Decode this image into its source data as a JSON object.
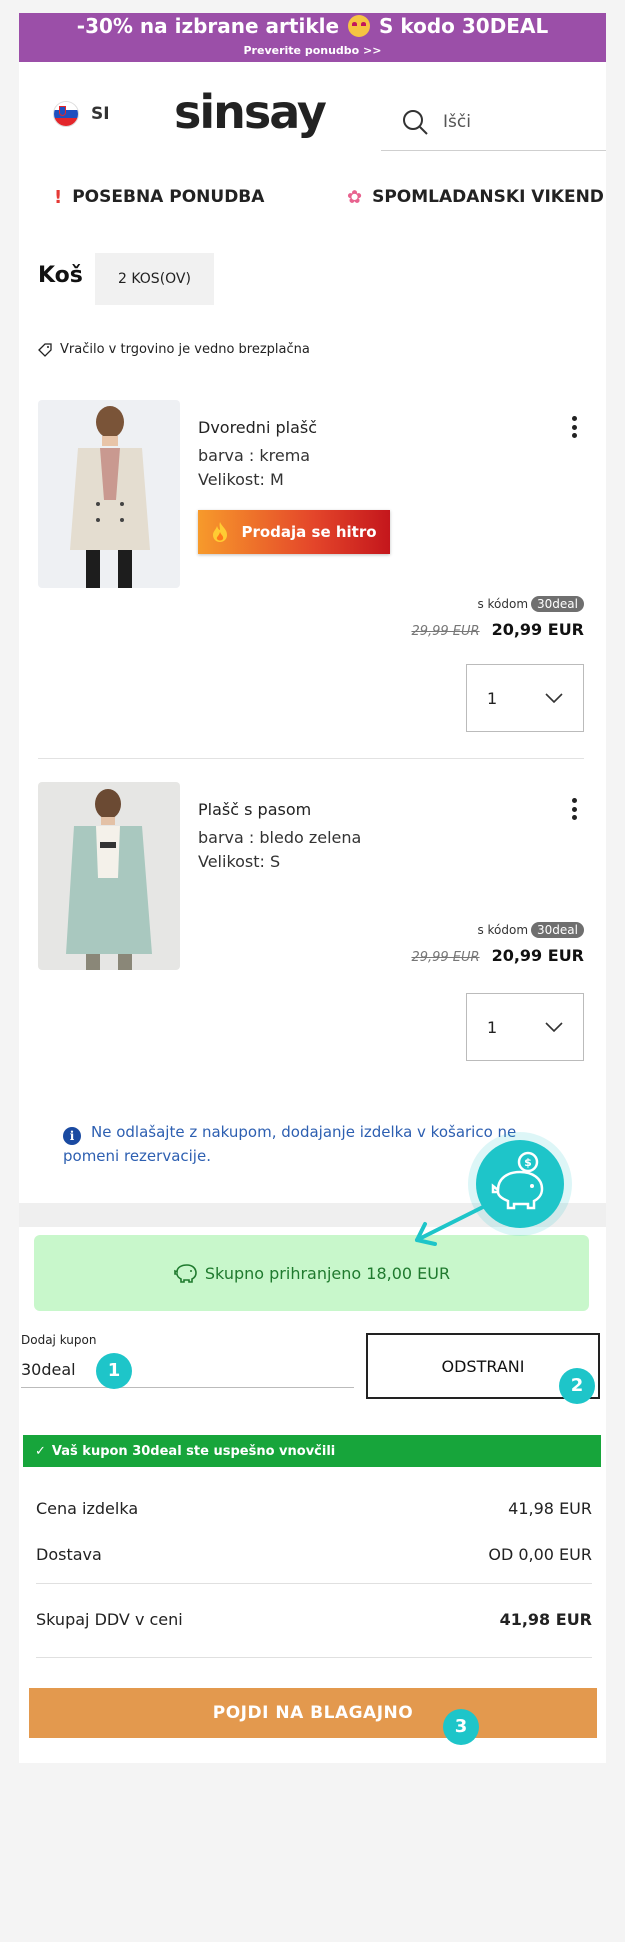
{
  "promo": {
    "text_before": "-30% na izbrane artikle",
    "text_after": "S kodo 30DEAL",
    "subtext": "Preverite ponudbo >>"
  },
  "header": {
    "language": "SI",
    "logo": "sinsay",
    "search_placeholder": "Išči"
  },
  "nav": [
    {
      "label": "POSEBNA PONUDBA",
      "icon": "exclamation-icon"
    },
    {
      "label": "SPOMLADANSKI VIKEND",
      "icon": "flower-icon"
    }
  ],
  "cart": {
    "title": "Koš",
    "count": "2 KOS(OV)",
    "returns_note": "Vračilo v trgovino je vedno brezplačna"
  },
  "products": [
    {
      "name": "Dvoredni plašč",
      "color": "barva : krema",
      "size": "Velikost: M",
      "badge": "Prodaja se hitro",
      "code_prefix": "s kódom",
      "code": "30deal",
      "old_price": "29,99 EUR",
      "new_price": "20,99 EUR",
      "quantity": "1"
    },
    {
      "name": "Plašč s pasom",
      "color": "barva : bledo zelena",
      "size": "Velikost: S",
      "code_prefix": "s kódom",
      "code": "30deal",
      "old_price": "29,99 EUR",
      "new_price": "20,99 EUR",
      "quantity": "1"
    }
  ],
  "info_note": "Ne odlašajte z nakupom, dodajanje izdelka v košarico ne pomeni rezervacije.",
  "savings": "Skupno prihranjeno 18,00 EUR",
  "coupon": {
    "label": "Dodaj kupon",
    "value": "30deal",
    "remove_label": "ODSTRANI",
    "success": "Vaš kupon 30deal ste uspešno vnovčili"
  },
  "summary": {
    "items_label": "Cena izdelka",
    "items_value": "41,98 EUR",
    "shipping_label": "Dostava",
    "shipping_value": "OD 0,00 EUR",
    "total_label": "Skupaj DDV v ceni",
    "total_value": "41,98 EUR"
  },
  "checkout_label": "POJDI NA BLAGAJNO",
  "annotations": {
    "step1": "1",
    "step2": "2",
    "step3": "3"
  },
  "colors": {
    "promo_bg": "#9b4fa8",
    "checkout_bg": "#e3994e",
    "success_bg": "#17a53b",
    "savings_bg": "#c8f7cb",
    "annotation": "#1ec5c9"
  }
}
